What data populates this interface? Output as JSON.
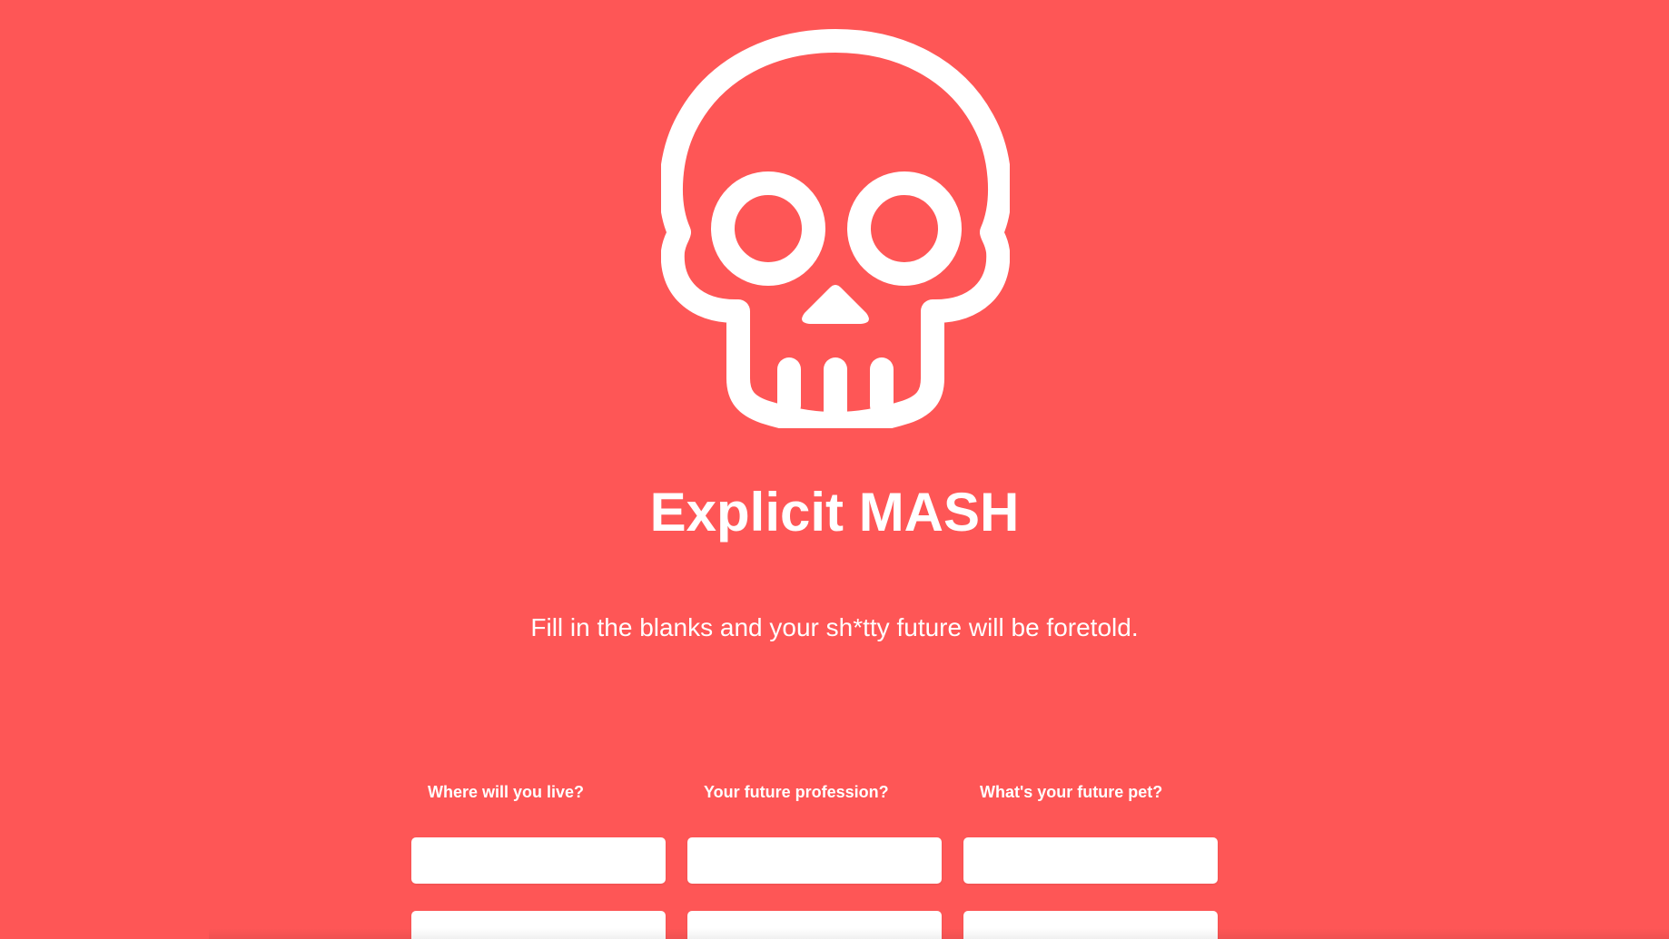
{
  "app": {
    "title": "Explicit MASH",
    "subtitle": "Fill in the blanks and your sh*tty future will be foretold.",
    "logo_icon": "skull-icon",
    "background_color": "#fe5656",
    "text_color": "#ffffff"
  },
  "form": {
    "columns": [
      {
        "label": "Where will you live?",
        "inputs": [
          {
            "value": "",
            "placeholder": ""
          },
          {
            "value": "",
            "placeholder": ""
          }
        ]
      },
      {
        "label": "Your future profession?",
        "inputs": [
          {
            "value": "",
            "placeholder": ""
          },
          {
            "value": "",
            "placeholder": ""
          }
        ]
      },
      {
        "label": "What's your future pet?",
        "inputs": [
          {
            "value": "",
            "placeholder": ""
          },
          {
            "value": "",
            "placeholder": ""
          }
        ]
      }
    ]
  }
}
